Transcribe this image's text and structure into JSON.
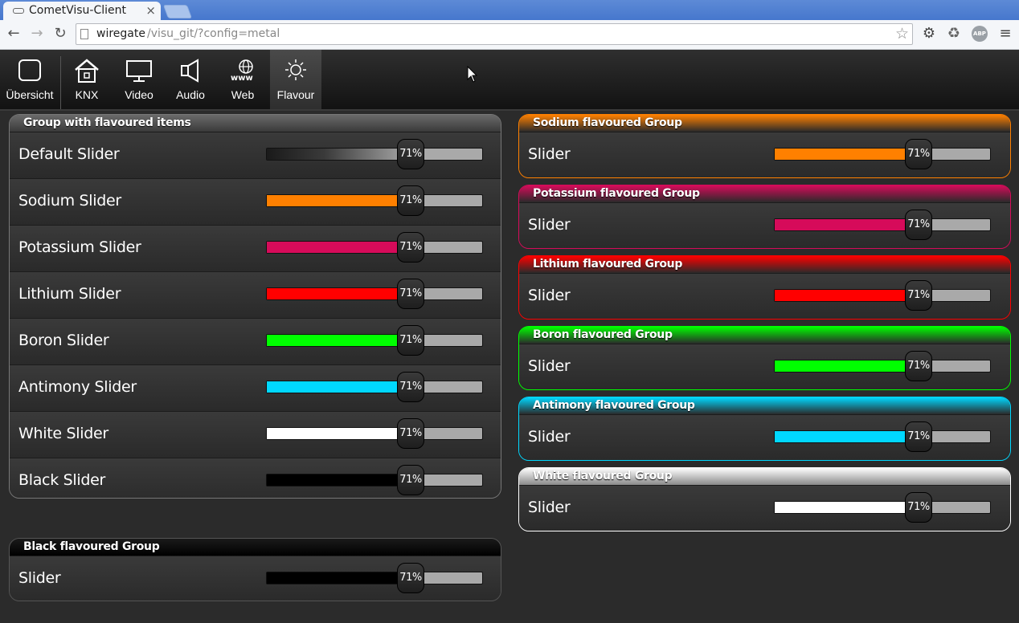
{
  "browser": {
    "tab_title": "CometVisu-Client",
    "url_host": "wiregate",
    "url_path": "/visu_git/?config=metal"
  },
  "nav": {
    "items": [
      {
        "label": "Übersicht",
        "icon": "square-icon"
      },
      {
        "label": "KNX",
        "icon": "house-icon"
      },
      {
        "label": "Video",
        "icon": "monitor-icon"
      },
      {
        "label": "Audio",
        "icon": "speaker-icon"
      },
      {
        "label": "Web",
        "icon": "globe-www-icon"
      },
      {
        "label": "Flavour",
        "icon": "sun-icon"
      }
    ],
    "active": "Flavour"
  },
  "groups": {
    "main": {
      "title": "Group with flavoured items",
      "rows": [
        {
          "label": "Default Slider",
          "value": 0.71,
          "display": "71%",
          "color": "gradient"
        },
        {
          "label": "Sodium Slider",
          "value": 0.71,
          "display": "71%",
          "color": "#ff8000"
        },
        {
          "label": "Potassium Slider",
          "value": 0.71,
          "display": "71%",
          "color": "#d60b5a"
        },
        {
          "label": "Lithium Slider",
          "value": 0.71,
          "display": "71%",
          "color": "#ff0000"
        },
        {
          "label": "Boron Slider",
          "value": 0.71,
          "display": "71%",
          "color": "#00ff00"
        },
        {
          "label": "Antimony Slider",
          "value": 0.71,
          "display": "71%",
          "color": "#00d8ff"
        },
        {
          "label": "White Slider",
          "value": 0.71,
          "display": "71%",
          "color": "#ffffff"
        },
        {
          "label": "Black Slider",
          "value": 0.71,
          "display": "71%",
          "color": "#000000"
        }
      ]
    },
    "black": {
      "title": "Black flavoured Group",
      "slider_label": "Slider",
      "display": "71%",
      "value": 0.71,
      "color": "#000000"
    },
    "sodium": {
      "title": "Sodium flavoured Group",
      "slider_label": "Slider",
      "display": "71%",
      "value": 0.71,
      "color": "#ff8000"
    },
    "potassium": {
      "title": "Potassium flavoured Group",
      "slider_label": "Slider",
      "display": "71%",
      "value": 0.71,
      "color": "#d60b5a"
    },
    "lithium": {
      "title": "Lithium flavoured Group",
      "slider_label": "Slider",
      "display": "71%",
      "value": 0.71,
      "color": "#ff0000"
    },
    "boron": {
      "title": "Boron flavoured Group",
      "slider_label": "Slider",
      "display": "71%",
      "value": 0.71,
      "color": "#00ff00"
    },
    "antimony": {
      "title": "Antimony flavoured Group",
      "slider_label": "Slider",
      "display": "71%",
      "value": 0.71,
      "color": "#00d8ff"
    },
    "white": {
      "title": "White flavoured Group",
      "slider_label": "Slider",
      "display": "71%",
      "value": 0.71,
      "color": "#ffffff"
    }
  }
}
